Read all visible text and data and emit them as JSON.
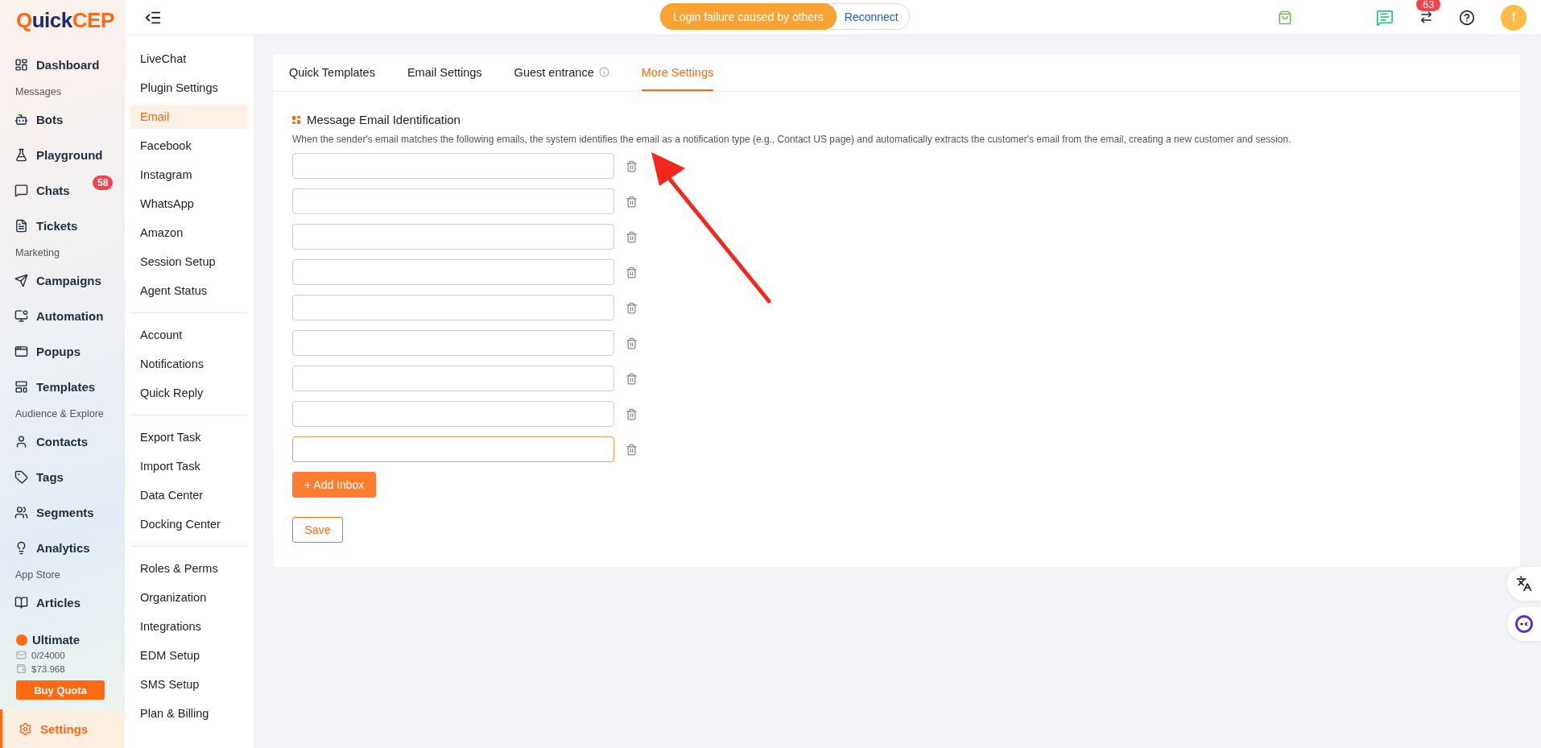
{
  "logo": [
    "Q",
    "uick",
    "CEP"
  ],
  "nav": [
    {
      "kind": "item",
      "label": "Dashboard",
      "selected": false
    },
    {
      "kind": "section",
      "label": "Messages"
    },
    {
      "kind": "item",
      "label": "Bots",
      "selected": false
    },
    {
      "kind": "item",
      "label": "Playground",
      "selected": false
    },
    {
      "kind": "item",
      "label": "Chats",
      "selected": false,
      "badge": "58"
    },
    {
      "kind": "item",
      "label": "Tickets",
      "selected": false
    },
    {
      "kind": "section",
      "label": "Marketing"
    },
    {
      "kind": "item",
      "label": "Campaigns",
      "selected": false
    },
    {
      "kind": "item",
      "label": "Automation",
      "selected": false
    },
    {
      "kind": "item",
      "label": "Popups",
      "selected": false
    },
    {
      "kind": "item",
      "label": "Templates",
      "selected": false
    },
    {
      "kind": "section",
      "label": "Audience & Explore"
    },
    {
      "kind": "item",
      "label": "Contacts",
      "selected": false
    },
    {
      "kind": "item",
      "label": "Tags",
      "selected": false
    },
    {
      "kind": "item",
      "label": "Segments",
      "selected": false
    },
    {
      "kind": "item",
      "label": "Analytics",
      "selected": false
    },
    {
      "kind": "section",
      "label": "App Store"
    },
    {
      "kind": "item",
      "label": "Articles",
      "selected": false
    }
  ],
  "plan": {
    "name": "Ultimate",
    "emails": "0/24000",
    "balance": "$73.968",
    "button": "Buy Quota"
  },
  "settings_nav": {
    "label": "Settings",
    "selected": true
  },
  "subnav": [
    [
      {
        "label": "LiveChat",
        "selected": false
      },
      {
        "label": "Plugin Settings",
        "selected": false
      },
      {
        "label": "Email",
        "selected": true
      },
      {
        "label": "Facebook",
        "selected": false
      },
      {
        "label": "Instagram",
        "selected": false
      },
      {
        "label": "WhatsApp",
        "selected": false
      },
      {
        "label": "Amazon",
        "selected": false
      },
      {
        "label": "Session Setup",
        "selected": false
      },
      {
        "label": "Agent Status",
        "selected": false
      }
    ],
    [
      {
        "label": "Account",
        "selected": false
      },
      {
        "label": "Notifications",
        "selected": false
      },
      {
        "label": "Quick Reply",
        "selected": false
      }
    ],
    [
      {
        "label": "Export Task",
        "selected": false
      },
      {
        "label": "Import Task",
        "selected": false
      },
      {
        "label": "Data Center",
        "selected": false
      },
      {
        "label": "Docking Center",
        "selected": false
      }
    ],
    [
      {
        "label": "Roles & Perms",
        "selected": false
      },
      {
        "label": "Organization",
        "selected": false
      },
      {
        "label": "Integrations",
        "selected": false
      },
      {
        "label": "EDM Setup",
        "selected": false
      },
      {
        "label": "SMS Setup",
        "selected": false
      },
      {
        "label": "Plan & Billing",
        "selected": false
      }
    ]
  ],
  "topbar": {
    "status": "Login failure caused by others",
    "action": "Reconnect",
    "notifications": "63",
    "avatar": "f"
  },
  "tabs": [
    {
      "label": "Quick Templates",
      "selected": false,
      "info": false
    },
    {
      "label": "Email Settings",
      "selected": false,
      "info": false
    },
    {
      "label": "Guest entrance",
      "selected": false,
      "info": true
    },
    {
      "label": "More Settings",
      "selected": true,
      "info": false
    }
  ],
  "section": {
    "title": "Message Email Identification",
    "description": "When the sender's email matches the following emails, the system identifies the email as a notification type (e.g., Contact US page) and automatically extracts the customer's email from the email, creating a new customer and session."
  },
  "inboxes": [
    {
      "focused": false
    },
    {
      "focused": false
    },
    {
      "focused": false
    },
    {
      "focused": false
    },
    {
      "focused": false
    },
    {
      "focused": false
    },
    {
      "focused": false
    },
    {
      "focused": false
    },
    {
      "focused": true
    }
  ],
  "add_button": "+ Add Inbox",
  "save_button": "Save"
}
